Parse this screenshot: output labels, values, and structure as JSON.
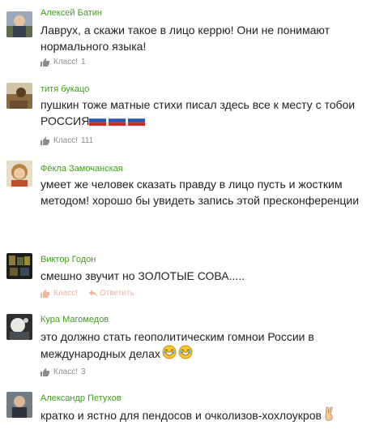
{
  "comments": [
    {
      "author": "Алексей Батин",
      "text": "Лаврух, а скажи такое в лицо керрю! Они не понимают нормального языка!",
      "like_label": "Класс!",
      "like_count": "1"
    },
    {
      "author": "титя букацо",
      "text": "пушкин тоже матные стихи писал здесь все к месту с тобои РОССИЯ",
      "like_label": "Класс!",
      "like_count": "111"
    },
    {
      "author": "Фёкла Замочанская",
      "text": "умеет же человек сказать правду в лицо пусть и жостким методом! хорошо бы увидеть запись этой пресконференции"
    },
    {
      "author": "Виктор Годон",
      "text": "смешно звучит но ЗОЛОТЫЕ СОВА.....",
      "like_label": "Класс!",
      "reply_label": "Ответить"
    },
    {
      "author": "Кура Магомедов",
      "text": "это должно стать геополитическим гомнои России в международных делах",
      "like_label": "Класс!",
      "like_count": "3"
    },
    {
      "author": "Александр Петухов",
      "text": "кратко и ястно для пендосов и очколизов-хохлоукров"
    }
  ],
  "colors": {
    "author": "#3f9b1d",
    "text": "#222222",
    "meta": "#8c8c8c",
    "meta_hover": "#f2b49f"
  },
  "icons": [
    "like-icon",
    "reply-icon",
    "russia-flag-icon",
    "laughing-emoji-icon",
    "victory-hand-icon"
  ]
}
